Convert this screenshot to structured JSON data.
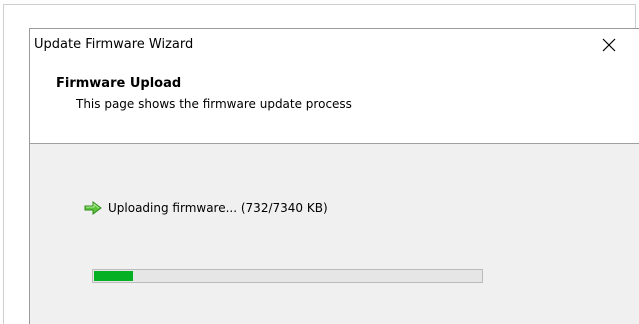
{
  "window": {
    "title": "Update Firmware Wizard",
    "close_glyph": "✕"
  },
  "header": {
    "title": "Firmware Upload",
    "subtitle": "This page shows the firmware update process"
  },
  "status": {
    "icon": "green-arrow-icon",
    "text": "Uploading firmware... (732/7340 KB)"
  },
  "progress": {
    "uploaded_kb": 732,
    "total_kb": 7340,
    "fraction": 0.0997,
    "fill_color": "#06b025"
  }
}
